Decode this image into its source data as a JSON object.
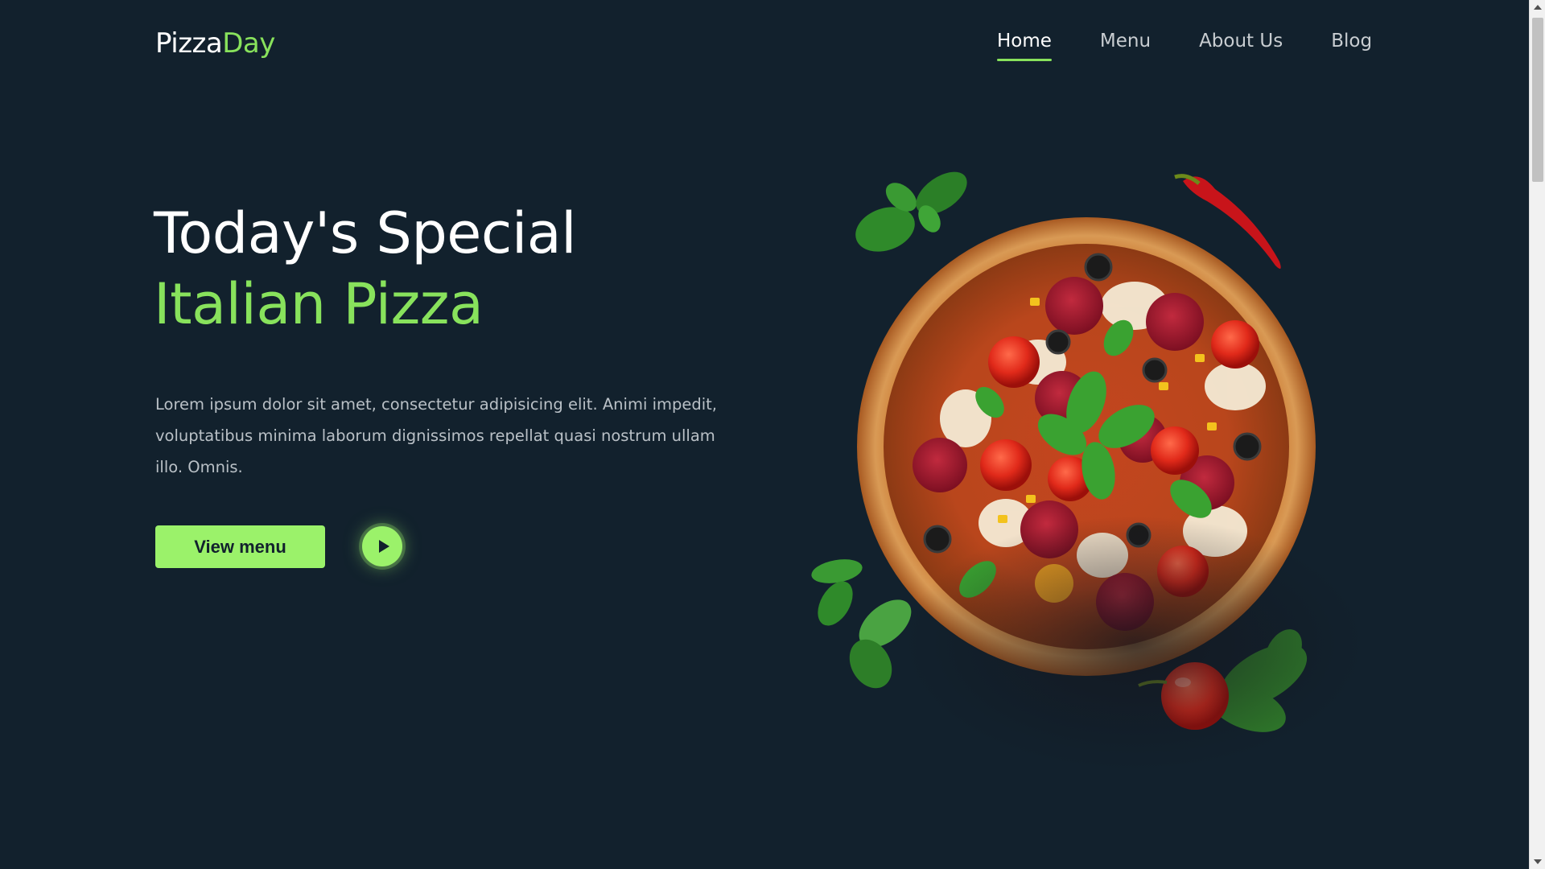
{
  "brand": {
    "part1": "Pizza",
    "part2": "Day"
  },
  "nav": {
    "items": [
      {
        "label": "Home",
        "active": true
      },
      {
        "label": "Menu",
        "active": false
      },
      {
        "label": "About Us",
        "active": false
      },
      {
        "label": "Blog",
        "active": false
      }
    ]
  },
  "hero": {
    "title": "Today's Special",
    "subtitle": "Italian Pizza",
    "description": "Lorem ipsum dolor sit amet, consectetur adipisicing elit. Animi impedit, voluptatibus minima laborum dignissimos repellat quasi nostrum ullam illo. Omnis.",
    "primary_button": "View menu",
    "play_icon": "play-icon"
  },
  "colors": {
    "background": "#12212d",
    "accent": "#88e25c",
    "button": "#9bf26a"
  }
}
